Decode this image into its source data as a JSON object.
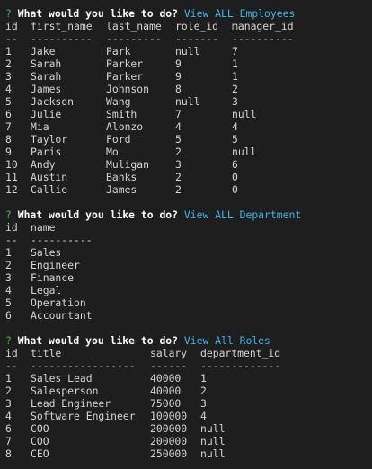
{
  "sections": [
    {
      "prompt": {
        "mark": "?",
        "question": "What would you like to do?",
        "answer": "View ALL Employees"
      },
      "columns": [
        "id",
        "first_name",
        "last_name",
        "role_id",
        "manager_id"
      ],
      "dividers": [
        "--",
        "----------",
        "---------",
        "-------",
        "----------"
      ],
      "rows": [
        [
          "1",
          "Jake",
          "Park",
          "null",
          "7"
        ],
        [
          "2",
          "Sarah",
          "Parker",
          "9",
          "1"
        ],
        [
          "3",
          "Sarah",
          "Parker",
          "9",
          "1"
        ],
        [
          "4",
          "James",
          "Johnson",
          "8",
          "2"
        ],
        [
          "5",
          "Jackson",
          "Wang",
          "null",
          "3"
        ],
        [
          "6",
          "Julie",
          "Smith",
          "7",
          "null"
        ],
        [
          "7",
          "Mia",
          "Alonzo",
          "4",
          "4"
        ],
        [
          "8",
          "Taylor",
          "Ford",
          "5",
          "5"
        ],
        [
          "9",
          "Paris",
          "Mo",
          "2",
          "null"
        ],
        [
          "10",
          "Andy",
          "Muligan",
          "3",
          "6"
        ],
        [
          "11",
          "Austin",
          "Banks",
          "2",
          "0"
        ],
        [
          "12",
          "Callie",
          "James",
          "2",
          "0"
        ]
      ]
    },
    {
      "prompt": {
        "mark": "?",
        "question": "What would you like to do?",
        "answer": "View ALL Department"
      },
      "columns": [
        "id",
        "name"
      ],
      "dividers": [
        "--",
        "----------"
      ],
      "rows": [
        [
          "1",
          "Sales"
        ],
        [
          "2",
          "Engineer"
        ],
        [
          "3",
          "Finance"
        ],
        [
          "4",
          "Legal"
        ],
        [
          "5",
          "Operation"
        ],
        [
          "6",
          "Accountant"
        ]
      ]
    },
    {
      "prompt": {
        "mark": "?",
        "question": "What would you like to do?",
        "answer": "View All Roles"
      },
      "columns": [
        "id",
        "title",
        "salary",
        "department_id"
      ],
      "dividers": [
        "--",
        "-----------------",
        "------",
        "-------------"
      ],
      "rows": [
        [
          "1",
          "Sales Lead",
          "40000",
          "1"
        ],
        [
          "2",
          "Salesperson",
          "40000",
          "2"
        ],
        [
          "3",
          "Lead Engineer",
          "75000",
          "3"
        ],
        [
          "4",
          "Software Engineer",
          "100000",
          "4"
        ],
        [
          "6",
          "COO",
          "200000",
          "null"
        ],
        [
          "7",
          "COO",
          "200000",
          "null"
        ],
        [
          "8",
          "CEO",
          "250000",
          "null"
        ]
      ]
    }
  ]
}
